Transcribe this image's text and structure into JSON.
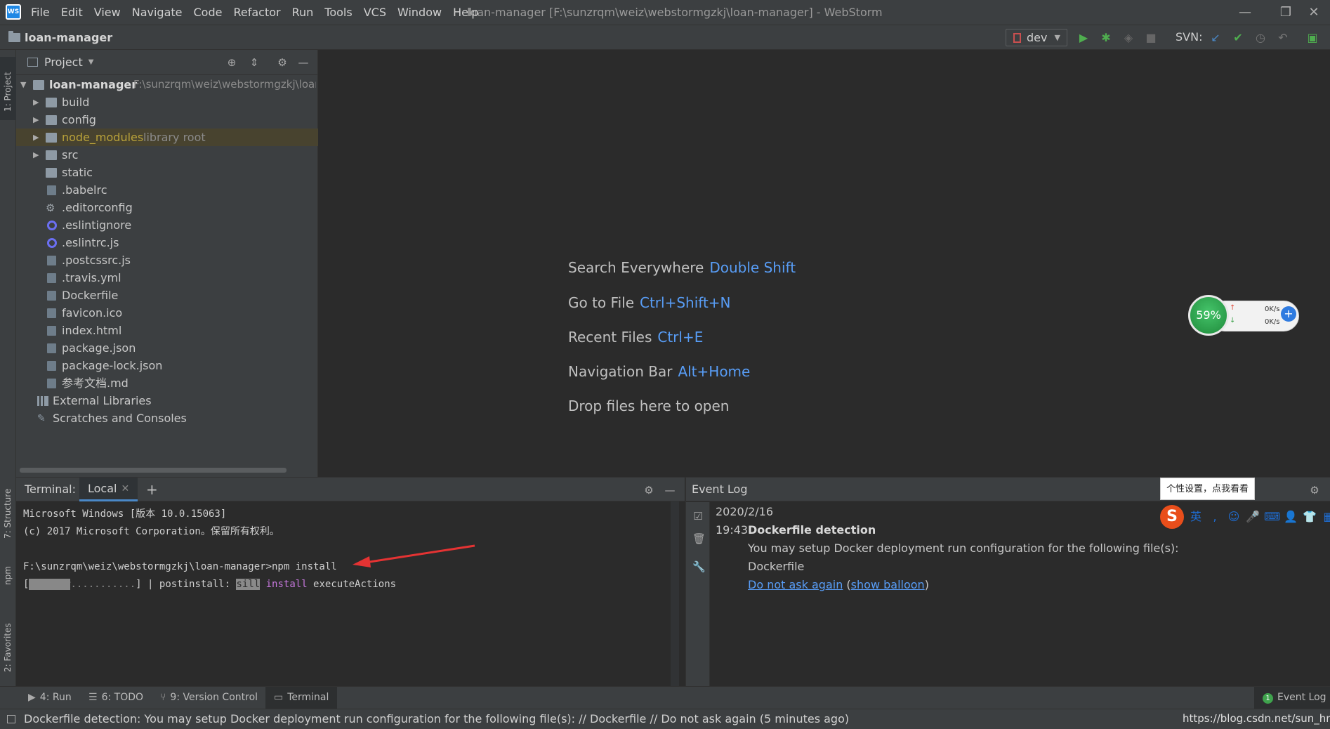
{
  "window": {
    "title": "loan-manager [F:\\sunzrqm\\weiz\\webstormgzkj\\loan-manager] - WebStorm",
    "logo": "WS",
    "menu": [
      "File",
      "Edit",
      "View",
      "Navigate",
      "Code",
      "Refactor",
      "Run",
      "Tools",
      "VCS",
      "Window",
      "Help"
    ],
    "controls": {
      "minimize": "—",
      "restore": "❐",
      "close": "✕"
    }
  },
  "navbar": {
    "breadcrumb": "loan-manager",
    "run_config": "dev",
    "svn_label": "SVN:"
  },
  "left_stripe": {
    "project": "1: Project",
    "structure": "7: Structure",
    "npm": "npm",
    "favorites": "2: Favorites"
  },
  "project_panel": {
    "title": "Project",
    "root": {
      "name": "loan-manager",
      "path": "F:\\sunzrqm\\weiz\\webstormgzkj\\loan"
    },
    "items": [
      {
        "label": "build",
        "type": "folder",
        "expandable": true
      },
      {
        "label": "config",
        "type": "folder",
        "expandable": true
      },
      {
        "label": "node_modules",
        "hint": "library root",
        "type": "folder",
        "expandable": true,
        "selected": true
      },
      {
        "label": "src",
        "type": "folder",
        "expandable": true
      },
      {
        "label": "static",
        "type": "folder"
      },
      {
        "label": ".babelrc",
        "type": "file"
      },
      {
        "label": ".editorconfig",
        "type": "gear"
      },
      {
        "label": ".eslintignore",
        "type": "ring"
      },
      {
        "label": ".eslintrc.js",
        "type": "ring"
      },
      {
        "label": ".postcssrc.js",
        "type": "file"
      },
      {
        "label": ".travis.yml",
        "type": "file"
      },
      {
        "label": "Dockerfile",
        "type": "file"
      },
      {
        "label": "favicon.ico",
        "type": "file"
      },
      {
        "label": "index.html",
        "type": "file"
      },
      {
        "label": "package.json",
        "type": "file"
      },
      {
        "label": "package-lock.json",
        "type": "file"
      },
      {
        "label": "参考文档.md",
        "type": "file"
      }
    ],
    "external_libraries": "External Libraries",
    "scratches": "Scratches and Consoles"
  },
  "editor_hints": [
    {
      "label": "Search Everywhere",
      "key": "Double Shift"
    },
    {
      "label": "Go to File",
      "key": "Ctrl+Shift+N"
    },
    {
      "label": "Recent Files",
      "key": "Ctrl+E"
    },
    {
      "label": "Navigation Bar",
      "key": "Alt+Home"
    },
    {
      "label": "Drop files here to open",
      "key": ""
    }
  ],
  "net_widget": {
    "percent": "59%",
    "up": "0K/s",
    "down": "0K/s"
  },
  "terminal": {
    "title": "Terminal:",
    "tab": "Local",
    "lines": {
      "l1": "Microsoft Windows [版本 10.0.15063]",
      "l2": "(c) 2017 Microsoft Corporation。保留所有权利。",
      "l3": "F:\\sunzrqm\\weiz\\webstormgzkj\\loan-manager>npm install",
      "l4_open": "[",
      "l4_fill": "#######",
      "l4_dots": "...........",
      "l4_mid": "] | postinstall: ",
      "l4_sill": "sill",
      "l4_install": " install",
      "l4_end": " executeActions"
    }
  },
  "event_log": {
    "title": "Event Log",
    "date": "2020/2/16",
    "time": "19:43",
    "heading": "Dockerfile detection",
    "message": "You may setup Docker deployment run configuration for the following file(s):",
    "file": "Dockerfile",
    "link_no_ask": "Do not ask again",
    "link_balloon": "show balloon",
    "paren_open": "(",
    "paren_close": ")"
  },
  "ime": {
    "tooltip": "个性设置，点我看看",
    "logo": "S",
    "lang": "英"
  },
  "bottom_tabs": {
    "run": "4: Run",
    "todo": "6: TODO",
    "vcs": "9: Version Control",
    "terminal": "Terminal",
    "event_log": "Event Log",
    "event_count": "1"
  },
  "status": {
    "text": "Dockerfile detection: You may setup Docker deployment run configuration for the following file(s): // Dockerfile // Do not ask again (5 minutes ago)",
    "watermark": "https://blog.csdn.net/sun_hm"
  },
  "colors": {
    "accent": "#589df6",
    "selected_row": "#48432f",
    "node_modules": "#b9a23a"
  }
}
